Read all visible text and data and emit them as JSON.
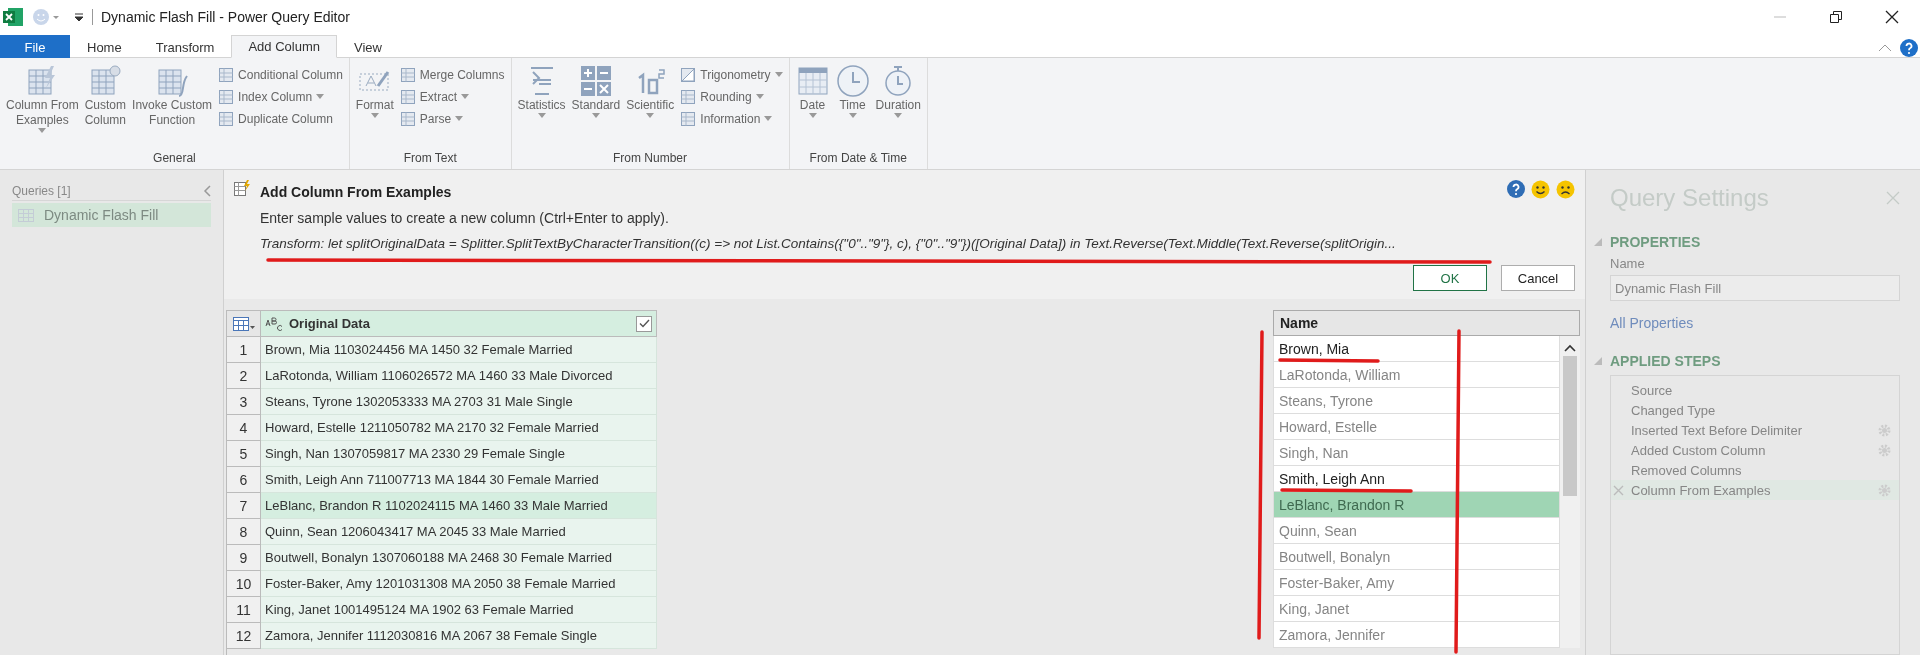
{
  "window": {
    "title": "Dynamic Flash Fill - Power Query Editor"
  },
  "tabs": [
    {
      "label": "File",
      "kind": "file",
      "selected": false
    },
    {
      "label": "Home",
      "kind": "tab",
      "selected": false
    },
    {
      "label": "Transform",
      "kind": "tab",
      "selected": false
    },
    {
      "label": "Add Column",
      "kind": "tab",
      "selected": true
    },
    {
      "label": "View",
      "kind": "tab",
      "selected": false
    }
  ],
  "ribbon": [
    {
      "label": "General",
      "big": [
        {
          "label": "Column From\nExamples",
          "dropdown": true
        },
        {
          "label": "Custom\nColumn",
          "dropdown": false
        },
        {
          "label": "Invoke Custom\nFunction",
          "dropdown": false
        }
      ],
      "small": [
        {
          "label": "Conditional Column",
          "dropdown": false
        },
        {
          "label": "Index Column",
          "dropdown": true
        },
        {
          "label": "Duplicate Column",
          "dropdown": false
        }
      ]
    },
    {
      "label": "From Text",
      "big": [
        {
          "label": "Format",
          "dropdown": true
        }
      ],
      "small": [
        {
          "label": "Merge Columns",
          "dropdown": false
        },
        {
          "label": "Extract",
          "dropdown": true
        },
        {
          "label": "Parse",
          "dropdown": true
        }
      ]
    },
    {
      "label": "From Number",
      "big": [
        {
          "label": "Statistics",
          "dropdown": true
        },
        {
          "label": "Standard",
          "dropdown": true
        },
        {
          "label": "Scientific",
          "dropdown": true
        }
      ],
      "small": [
        {
          "label": "Trigonometry",
          "dropdown": true
        },
        {
          "label": "Rounding",
          "dropdown": true
        },
        {
          "label": "Information",
          "dropdown": true
        }
      ]
    },
    {
      "label": "From Date & Time",
      "big": [
        {
          "label": "Date",
          "dropdown": true
        },
        {
          "label": "Time",
          "dropdown": true
        },
        {
          "label": "Duration",
          "dropdown": true
        }
      ]
    }
  ],
  "queries": {
    "title": "Queries [1]",
    "items": [
      {
        "label": "Dynamic Flash Fill",
        "selected": true
      }
    ]
  },
  "examples_pane": {
    "title": "Add Column From Examples",
    "description": "Enter sample values to create a new column (Ctrl+Enter to apply).",
    "transform": "Transform: let splitOriginalData = Splitter.SplitTextByCharacterTransition((c) => not List.Contains({\"0\"..\"9\"}, c), {\"0\"..\"9\"})([Original Data]) in Text.Reverse(Text.Middle(Text.Reverse(splitOrigin...",
    "ok": "OK",
    "cancel": "Cancel"
  },
  "table": {
    "column": "Original Data",
    "checked": true,
    "rows": [
      {
        "n": "1",
        "value": "Brown, Mia 1103024456 MA 1450 32 Female Married",
        "selected": false
      },
      {
        "n": "2",
        "value": "LaRotonda, William 1106026572 MA 1460 33 Male Divorced",
        "selected": false
      },
      {
        "n": "3",
        "value": "Steans, Tyrone 1302053333 MA 2703 31 Male Single",
        "selected": false
      },
      {
        "n": "4",
        "value": "Howard, Estelle 1211050782 MA 2170 32 Female Married",
        "selected": false
      },
      {
        "n": "5",
        "value": "Singh, Nan 1307059817 MA 2330 29 Female Single",
        "selected": false
      },
      {
        "n": "6",
        "value": "Smith, Leigh Ann 711007713 MA 1844 30 Female Married",
        "selected": false
      },
      {
        "n": "7",
        "value": "LeBlanc, Brandon R 1102024115 MA 1460 33 Male Married",
        "selected": true
      },
      {
        "n": "8",
        "value": "Quinn, Sean 1206043417 MA 2045 33 Male Married",
        "selected": false
      },
      {
        "n": "9",
        "value": "Boutwell, Bonalyn 1307060188 MA 2468 30 Female Married",
        "selected": false
      },
      {
        "n": "10",
        "value": "Foster-Baker, Amy 1201031308 MA 2050 38 Female Married",
        "selected": false
      },
      {
        "n": "11",
        "value": "King, Janet 1001495124 MA 1902 63 Female Married",
        "selected": false
      },
      {
        "n": "12",
        "value": "Zamora, Jennifer 1112030816 MA 2067 38 Female Single",
        "selected": false
      }
    ]
  },
  "new_column": {
    "header": "Name",
    "cells": [
      {
        "value": "Brown, Mia",
        "example": true,
        "selected": false
      },
      {
        "value": "LaRotonda, William",
        "example": false,
        "selected": false
      },
      {
        "value": "Steans, Tyrone",
        "example": false,
        "selected": false
      },
      {
        "value": "Howard, Estelle",
        "example": false,
        "selected": false
      },
      {
        "value": "Singh, Nan",
        "example": false,
        "selected": false
      },
      {
        "value": "Smith, Leigh Ann",
        "example": true,
        "selected": false
      },
      {
        "value": "LeBlanc, Brandon R",
        "example": false,
        "selected": true
      },
      {
        "value": "Quinn, Sean",
        "example": false,
        "selected": false
      },
      {
        "value": "Boutwell, Bonalyn",
        "example": false,
        "selected": false
      },
      {
        "value": "Foster-Baker, Amy",
        "example": false,
        "selected": false
      },
      {
        "value": "King, Janet",
        "example": false,
        "selected": false
      },
      {
        "value": "Zamora, Jennifer",
        "example": false,
        "selected": false
      }
    ]
  },
  "query_settings": {
    "title": "Query Settings",
    "properties_title": "PROPERTIES",
    "name_label": "Name",
    "name_value": "Dynamic Flash Fill",
    "all_properties": "All Properties",
    "steps_title": "APPLIED STEPS",
    "steps": [
      {
        "label": "Source",
        "settings": false,
        "selected": false
      },
      {
        "label": "Changed Type",
        "settings": false,
        "selected": false
      },
      {
        "label": "Inserted Text Before Delimiter",
        "settings": true,
        "selected": false
      },
      {
        "label": "Added Custom Column",
        "settings": true,
        "selected": false
      },
      {
        "label": "Removed Columns",
        "settings": false,
        "selected": false
      },
      {
        "label": "Column From Examples",
        "settings": true,
        "selected": true
      }
    ]
  }
}
